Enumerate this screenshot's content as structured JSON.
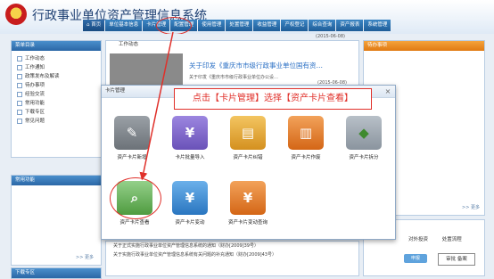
{
  "header": {
    "title": "行政事业单位资产管理信息系统",
    "nav": [
      "首页",
      "单位基本信息",
      "卡片管理",
      "配置管理",
      "使用管理",
      "处置管理",
      "收益管理",
      "产权登记",
      "综合查询",
      "资产报表",
      "系统管理"
    ]
  },
  "sidebar_menu": {
    "title": "菜单目录",
    "items": [
      "工作动态",
      "工作通知",
      "政策发布及解读",
      "待办事项",
      "经验交流",
      "常用功能",
      "下载专区",
      "常见问题"
    ]
  },
  "common": {
    "title": "常用功能",
    "more": ">> 更多"
  },
  "download": {
    "title": "下载专区"
  },
  "work": {
    "title": "工作动态",
    "news_title": "关于印发《重庆市市级行政事业单位国有资…",
    "news_line": "关于印发《重庆市市级行政事业单位办公设…",
    "date1": "(2015-06-08)",
    "date2": "(2015-06-08)"
  },
  "todo": {
    "title": "待办事项",
    "more": ">> 更多"
  },
  "flow": {
    "col1": "对外投资",
    "col2": "处置流程",
    "btn": "申报",
    "box": "审批  备案"
  },
  "bottom_news": [
    "关于正式实施行政事业单位资产管理信息系统的通知（财办[2009]39号）",
    "关于实施行政事业单位资产管理信息系统有关问题的补充通知（财办[2009]43号）"
  ],
  "modal": {
    "title": "卡片管理",
    "close": "×",
    "instruction": "点击【卡片管理】选择【资产卡片查看】",
    "tiles_row1": [
      "资产卡片新增",
      "卡片批量导入",
      "资产卡片纠错",
      "资产卡片作废",
      "资产卡片拆分"
    ],
    "tiles_row2": [
      "资产卡片查看",
      "资产卡片变动",
      "资产卡片变动查询"
    ]
  },
  "colors": {
    "accent": "#e0302a",
    "nav": "#2b67a6",
    "title": "#1d3f72"
  }
}
